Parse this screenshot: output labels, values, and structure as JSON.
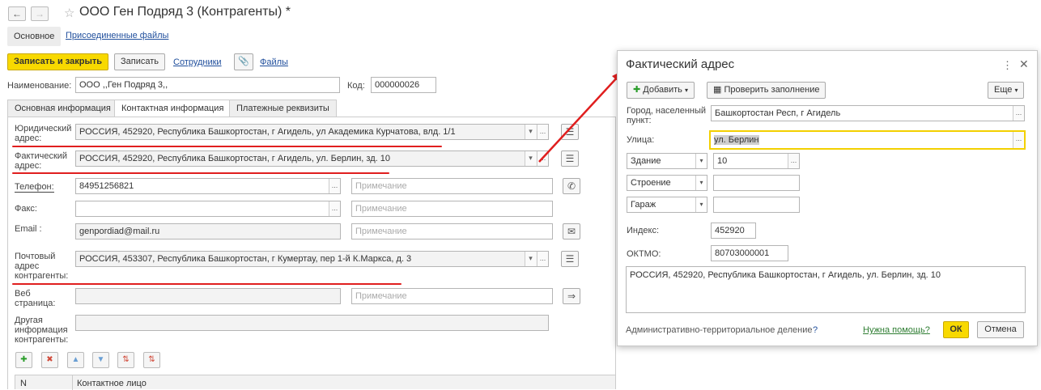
{
  "window": {
    "title": "ООО Ген Подряд 3 (Контрагенты) *",
    "back_icon": "arrow-left",
    "forward_icon": "arrow-right",
    "star_icon": "star-outline"
  },
  "subtabs": {
    "main": "Основное",
    "files": "Присоединенные файлы"
  },
  "toolbar": {
    "save_close": "Записать и закрыть",
    "save": "Записать",
    "employees": "Сотрудники",
    "files": "Файлы"
  },
  "header_fields": {
    "name_label": "Наименование:",
    "name_value": "ООО ,,Ген Подряд 3,,",
    "code_label": "Код:",
    "code_value": "000000026"
  },
  "tabs": [
    "Основная информация",
    "Контактная информация",
    "Платежные реквизиты"
  ],
  "contact": {
    "legal_label": "Юридический адрес:",
    "legal_value": "РОССИЯ, 452920, Республика Башкортостан, г Агидель, ул Академика Курчатова, влд. 1/1",
    "actual_label": "Фактический адрес:",
    "actual_value": "РОССИЯ, 452920, Республика Башкортостан, г Агидель, ул. Берлин, зд. 10",
    "phone_label": "Телефон:",
    "phone_value": "84951256821",
    "fax_label": "Факс:",
    "fax_value": "",
    "email_label": "Email :",
    "email_value": "genpordiad@mail.ru",
    "postal_label": "Почтовый адрес контрагенты:",
    "postal_value": "РОССИЯ, 453307, Республика Башкортостан, г Кумертау, пер 1-й К.Маркса, д. 3",
    "web_label": "Веб страница:",
    "web_value": "",
    "other_label": "Другая информация контрагенты:",
    "other_value": "",
    "note_placeholder": "Примечание"
  },
  "contacts_table": {
    "col_n": "N",
    "col_person": "Контактное лицо"
  },
  "dialog": {
    "title": "Фактический адрес",
    "add": "Добавить",
    "check": "Проверить заполнение",
    "more": "Еще",
    "city_label": "Город, населенный пункт:",
    "city_value": "Башкортостан Респ, г Агидель",
    "street_label": "Улица:",
    "street_value": "ул. Берлин",
    "building_type": "Здание",
    "building_value": "10",
    "structure_type": "Строение",
    "structure_value": "",
    "garage_type": "Гараж",
    "garage_value": "",
    "index_label": "Индекс:",
    "index_value": "452920",
    "oktmo_label": "ОКТМО:",
    "oktmo_value": "80703000001",
    "presentation": "РОССИЯ, 452920, Республика Башкортостан, г Агидель, ул. Берлин, зд. 10",
    "admin_division": "Административно-территориальное деление",
    "help_q": "?",
    "need_help": "Нужна помощь?",
    "ok": "ОК",
    "cancel": "Отмена"
  },
  "colors": {
    "accent_yellow": "#f8d900",
    "annotation_red": "#e01e1e",
    "link_blue": "#1f4e9c"
  }
}
